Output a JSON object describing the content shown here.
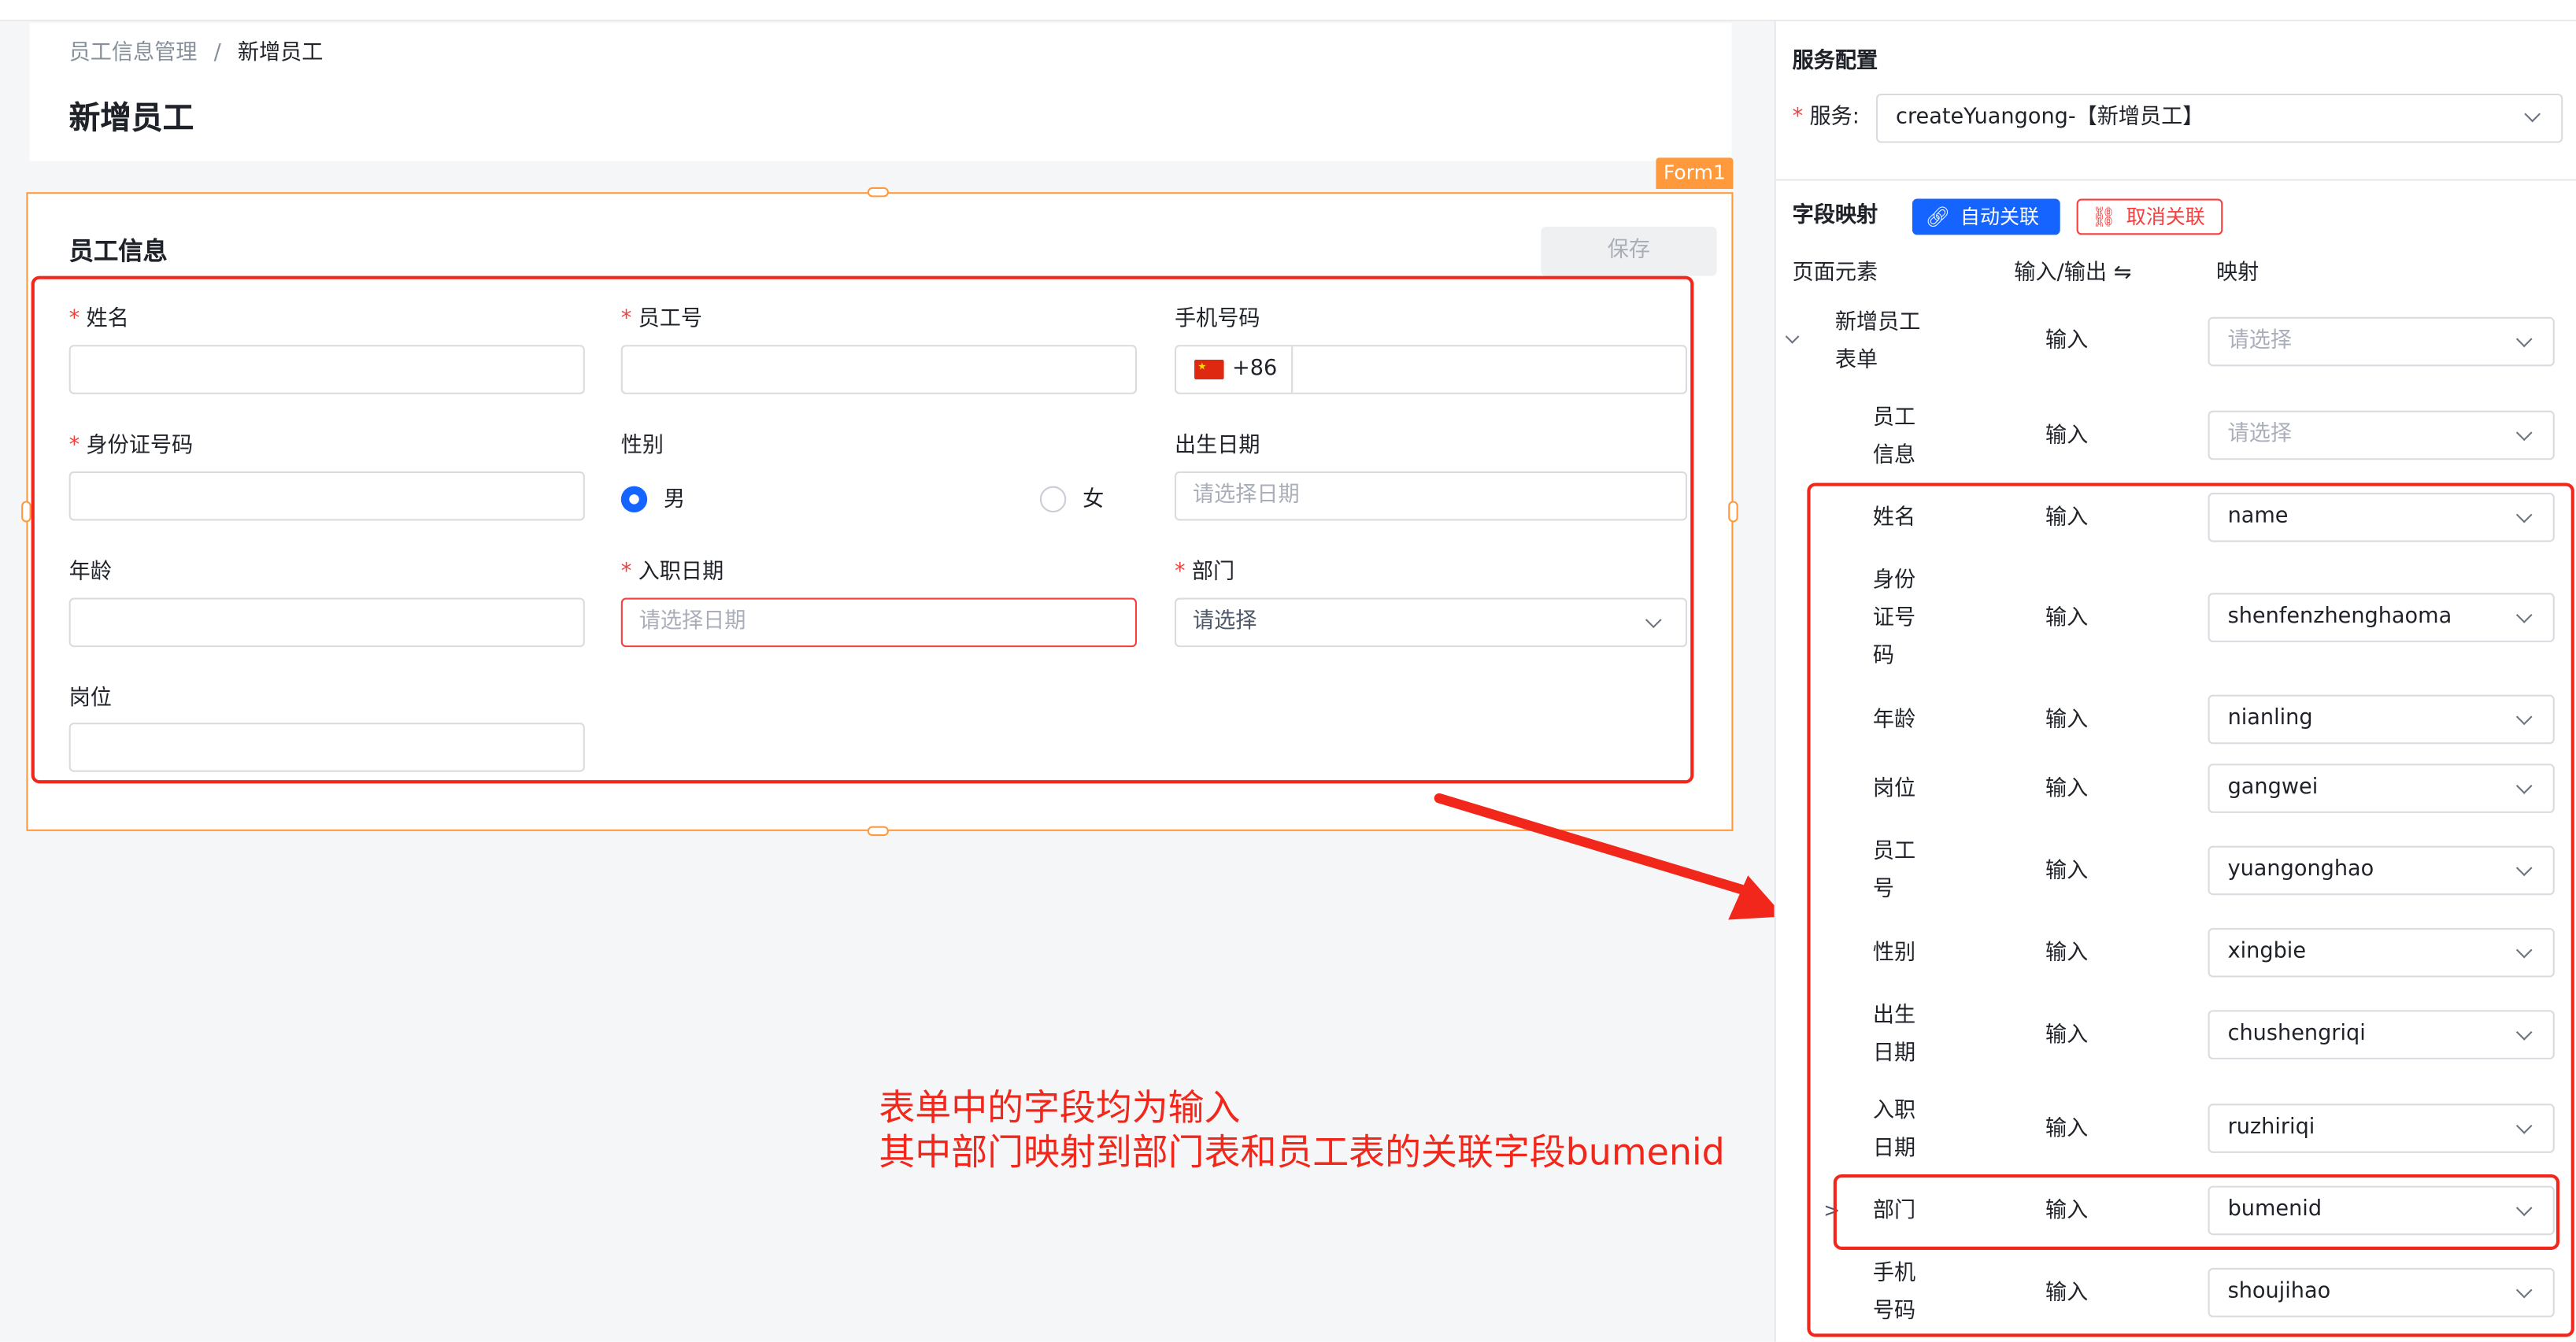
{
  "breadcrumb": {
    "parent": "员工信息管理",
    "separator": "/",
    "current": "新增员工"
  },
  "page_title": "新增员工",
  "form": {
    "tag": "Form1",
    "section_title": "员工信息",
    "save_label": "保存",
    "fields": {
      "name": {
        "label": "姓名",
        "value": ""
      },
      "employee_no": {
        "label": "员工号",
        "value": ""
      },
      "phone": {
        "label": "手机号码",
        "prefix": "+86",
        "value": ""
      },
      "id_no": {
        "label": "身份证号码",
        "value": ""
      },
      "gender": {
        "label": "性别",
        "options": [
          "男",
          "女"
        ],
        "selected": "男"
      },
      "birth_date": {
        "label": "出生日期",
        "placeholder": "请选择日期"
      },
      "age": {
        "label": "年龄",
        "value": ""
      },
      "hire_date": {
        "label": "入职日期",
        "placeholder": "请选择日期"
      },
      "department": {
        "label": "部门",
        "placeholder": "请选择"
      },
      "position": {
        "label": "岗位",
        "value": ""
      }
    }
  },
  "annotation": {
    "line1": "表单中的字段均为输入",
    "line2": "其中部门映射到部门表和员工表的关联字段bumenid"
  },
  "panel": {
    "service_config_title": "服务配置",
    "service_label": "服务:",
    "service_value": "createYuangong-【新增员工】",
    "field_mapping_title": "字段映射",
    "auto_link_label": "自动关联",
    "unlink_label": "取消关联",
    "columns": {
      "element": "页面元素",
      "io": "输入/输出 ⇋",
      "mapping": "映射"
    },
    "rows": [
      {
        "name": "新增员工表单",
        "io": "输入",
        "mapping": "请选择",
        "placeholder": true
      },
      {
        "name": "员工信息",
        "io": "输入",
        "mapping": "请选择",
        "placeholder": true
      },
      {
        "name": "姓名",
        "io": "输入",
        "mapping": "name"
      },
      {
        "name": "身份证号码",
        "io": "输入",
        "mapping": "shenfenzhenghaoma"
      },
      {
        "name": "年龄",
        "io": "输入",
        "mapping": "nianling"
      },
      {
        "name": "岗位",
        "io": "输入",
        "mapping": "gangwei"
      },
      {
        "name": "员工号",
        "io": "输入",
        "mapping": "yuangonghao"
      },
      {
        "name": "性别",
        "io": "输入",
        "mapping": "xingbie"
      },
      {
        "name": "出生日期",
        "io": "输入",
        "mapping": "chushengriqi"
      },
      {
        "name": "入职日期",
        "io": "输入",
        "mapping": "ruzhiriqi"
      },
      {
        "name": "部门",
        "io": "输入",
        "mapping": "bumenid"
      },
      {
        "name": "手机号码",
        "io": "输入",
        "mapping": "shoujihao"
      }
    ]
  },
  "colors": {
    "primary": "#1664ff",
    "required": "#f53f3f",
    "annotation": "#f2271c",
    "form_outline": "#ff9a3c"
  }
}
